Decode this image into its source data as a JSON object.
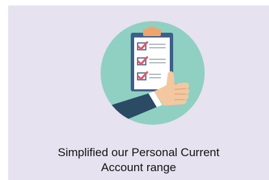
{
  "card": {
    "title_line1": "Simplified our Personal Current",
    "title_line2": "Account range",
    "background_color": "#e6e2ef"
  },
  "illustration": {
    "icon": "checklist-thumbs-up-icon",
    "circle_color": "#8fd0c2",
    "check_color": "#e0566e",
    "clipboard_color": "#ffffff",
    "clip_color": "#f0a46b"
  }
}
